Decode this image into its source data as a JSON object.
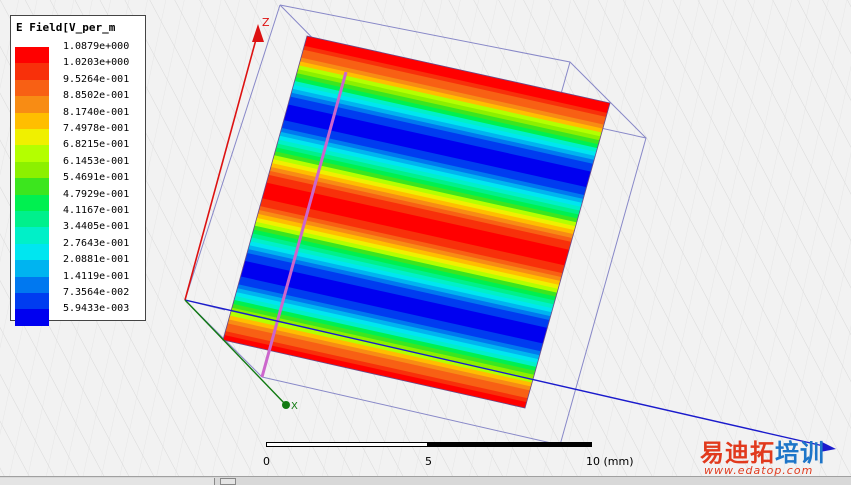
{
  "legend": {
    "title": "E Field[V_per_m",
    "entries": [
      {
        "label": "1.0879e+000",
        "color": "#ff0000"
      },
      {
        "label": "1.0203e+000",
        "color": "#f8300a"
      },
      {
        "label": "9.5264e-001",
        "color": "#f86014"
      },
      {
        "label": "8.8502e-001",
        "color": "#f88c14"
      },
      {
        "label": "8.1740e-001",
        "color": "#ffbe00"
      },
      {
        "label": "7.4978e-001",
        "color": "#f0f000"
      },
      {
        "label": "6.8215e-001",
        "color": "#b4ff00"
      },
      {
        "label": "6.1453e-001",
        "color": "#8cf000"
      },
      {
        "label": "5.4691e-001",
        "color": "#3ce61e"
      },
      {
        "label": "4.7929e-001",
        "color": "#00f050"
      },
      {
        "label": "4.1167e-001",
        "color": "#00f08c"
      },
      {
        "label": "3.4405e-001",
        "color": "#00f0c8"
      },
      {
        "label": "2.7643e-001",
        "color": "#00e6f0"
      },
      {
        "label": "2.0881e-001",
        "color": "#00b4f0"
      },
      {
        "label": "1.4119e-001",
        "color": "#0078f0"
      },
      {
        "label": "7.3564e-002",
        "color": "#003cf0"
      },
      {
        "label": "5.9433e-003",
        "color": "#0000f0"
      }
    ]
  },
  "field_bands": [
    {
      "label": "1.0879e+000",
      "role": "edge"
    },
    {
      "label": "5.9433e-003",
      "role": "upper trough"
    },
    {
      "label": "1.0879e+000",
      "role": "center crest"
    },
    {
      "label": "5.9433e-003",
      "role": "lower trough"
    },
    {
      "label": "1.0879e+000",
      "role": "edge"
    }
  ],
  "axes": {
    "z_label": "Z",
    "x_label": "X",
    "z_color": "#dd1111",
    "x_color": "#1a1acc",
    "y_color": "#117a11"
  },
  "scale": {
    "zero": "0",
    "mid": "5",
    "max": "10 (mm)"
  },
  "watermark": {
    "cn_red": "易迪拓",
    "cn_blue": "培训",
    "url": "www.edatop.com"
  }
}
